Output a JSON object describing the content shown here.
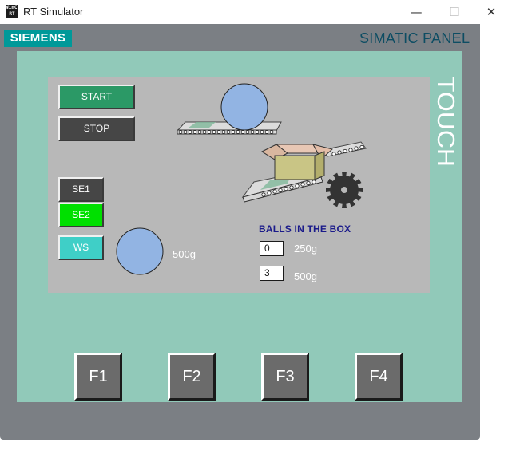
{
  "window": {
    "title": "RT Simulator",
    "icon_text": "WinCC RT",
    "minimize_glyph": "—",
    "maximize_glyph": "☐",
    "close_glyph": "✕"
  },
  "panel": {
    "brand": "SIEMENS",
    "name": "SIMATIC PANEL",
    "touch_label": "TOUCH"
  },
  "hmi": {
    "start_label": "START",
    "stop_label": "STOP",
    "indicators": [
      {
        "label": "SE1",
        "state": "off",
        "color": "#464646"
      },
      {
        "label": "SE2",
        "state": "on",
        "color": "#00e000"
      },
      {
        "label": "WS",
        "state": "on",
        "color": "#3fcfc7"
      }
    ],
    "weighed_ball_label": "500g",
    "counter_title": "BALLS IN THE BOX",
    "counters": [
      {
        "value": "0",
        "label": "250g"
      },
      {
        "value": "3",
        "label": "500g"
      }
    ]
  },
  "function_keys": [
    "F1",
    "F2",
    "F3",
    "F4"
  ],
  "colors": {
    "panel_body": "#7b7f84",
    "panel_frame": "#91c9b9",
    "screen_bg": "#b8b8b8",
    "brand_bg": "#009999",
    "start_button": "#2b9966",
    "ball": "#92b4e3"
  }
}
